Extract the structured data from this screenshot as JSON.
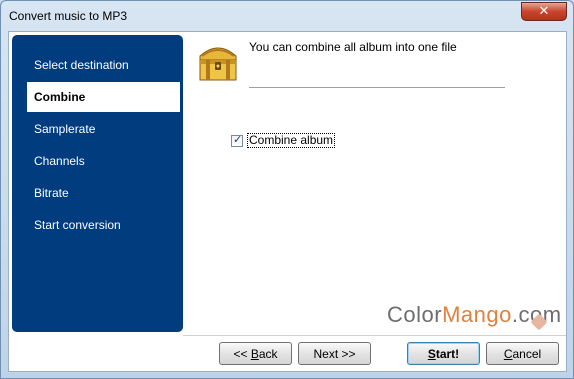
{
  "window": {
    "title": "Convert music to MP3",
    "close_glyph": "✕"
  },
  "sidebar": {
    "items": [
      {
        "label": "Select destination",
        "active": false
      },
      {
        "label": "Combine",
        "active": true
      },
      {
        "label": "Samplerate",
        "active": false
      },
      {
        "label": "Channels",
        "active": false
      },
      {
        "label": "Bitrate",
        "active": false
      },
      {
        "label": "Start conversion",
        "active": false
      }
    ]
  },
  "main": {
    "icon": "treasure-chest-icon",
    "heading": "You can combine all album into one file",
    "checkbox": {
      "label": "Combine album",
      "checked": true,
      "check_glyph": "✓"
    }
  },
  "watermark": {
    "part1": "Color",
    "part2": "Mango",
    "part3": ".com"
  },
  "buttons": {
    "back_prefix": "<< ",
    "back_access": "B",
    "back_rest": "ack",
    "next_label": "Next >>",
    "start_access": "S",
    "start_rest": "tart!",
    "cancel_access": "C",
    "cancel_rest": "ancel"
  },
  "colors": {
    "sidebar_bg": "#003c7e",
    "close_button": "#c9452c",
    "watermark_accent": "#e0813d"
  }
}
